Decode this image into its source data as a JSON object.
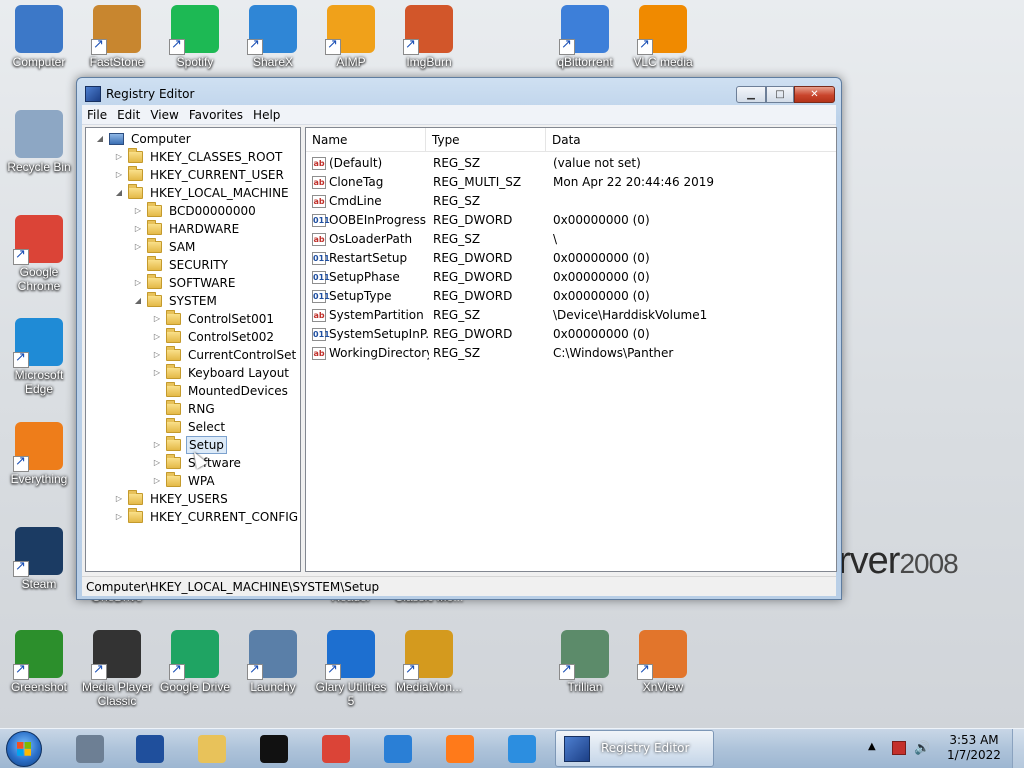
{
  "wallpaper": {
    "text": "rver",
    "small": "2008"
  },
  "desktop_icons": [
    {
      "label": "Computer",
      "icon": "computer-icon",
      "color": "#3c78c8"
    },
    {
      "label": "FastStone",
      "icon": "faststone-icon",
      "color": "#c8862f"
    },
    {
      "label": "Spotify",
      "icon": "spotify-icon",
      "color": "#1db954"
    },
    {
      "label": "ShareX",
      "icon": "sharex-icon",
      "color": "#2f86d6"
    },
    {
      "label": "AIMP",
      "icon": "aimp-icon",
      "color": "#f0a11a"
    },
    {
      "label": "ImgBurn",
      "icon": "imgburn-icon",
      "color": "#d2562a"
    },
    {
      "label": "qBittorrent",
      "icon": "qbittorrent-icon",
      "color": "#3d7fd9"
    },
    {
      "label": "VLC media",
      "icon": "vlc-icon",
      "color": "#f08a00"
    },
    {
      "label": "Recycle Bin",
      "icon": "recycle-bin-icon",
      "color": "#8da7c4"
    },
    {
      "label": "Google Chrome",
      "icon": "chrome-icon",
      "color": "#db4437"
    },
    {
      "label": "Microsoft Edge",
      "icon": "edge-icon",
      "color": "#1f8bd6"
    },
    {
      "label": "Everything",
      "icon": "everything-icon",
      "color": "#ee7d1a"
    },
    {
      "label": "Steam",
      "icon": "steam-icon",
      "color": "#1b3b63"
    },
    {
      "label": "OneDrive",
      "icon": "onedrive-icon",
      "color": "#2e74c7"
    },
    {
      "label": "Reader",
      "icon": "reader-icon",
      "color": "#c0302a"
    },
    {
      "label": "Classic Mo...",
      "icon": "classic-icon",
      "color": "#4a6a8f"
    },
    {
      "label": "Greenshot",
      "icon": "greenshot-icon",
      "color": "#2c8f2c"
    },
    {
      "label": "Media Player Classic",
      "icon": "media-player-icon",
      "color": "#333333"
    },
    {
      "label": "Google Drive",
      "icon": "google-drive-icon",
      "color": "#1fa463"
    },
    {
      "label": "Launchy",
      "icon": "launchy-icon",
      "color": "#5a7fa8"
    },
    {
      "label": "Glary Utilities 5",
      "icon": "glary-icon",
      "color": "#1d6fd0"
    },
    {
      "label": "MediaMon...",
      "icon": "mediamonkey-icon",
      "color": "#d49a1e"
    },
    {
      "label": "Trillian",
      "icon": "trillian-icon",
      "color": "#5c8b6a"
    },
    {
      "label": "XnView",
      "icon": "xnview-icon",
      "color": "#e2752b"
    }
  ],
  "window": {
    "title": "Registry Editor",
    "min_label": "▁",
    "max_label": "□",
    "close_label": "✕",
    "menu": [
      "File",
      "Edit",
      "View",
      "Favorites",
      "Help"
    ],
    "status_path": "Computer\\HKEY_LOCAL_MACHINE\\SYSTEM\\Setup"
  },
  "tree": [
    {
      "label": "Computer",
      "depth": 0,
      "exp": "◢",
      "kind": "computer"
    },
    {
      "label": "HKEY_CLASSES_ROOT",
      "depth": 1,
      "exp": "▷"
    },
    {
      "label": "HKEY_CURRENT_USER",
      "depth": 1,
      "exp": "▷"
    },
    {
      "label": "HKEY_LOCAL_MACHINE",
      "depth": 1,
      "exp": "◢"
    },
    {
      "label": "BCD00000000",
      "depth": 2,
      "exp": "▷"
    },
    {
      "label": "HARDWARE",
      "depth": 2,
      "exp": "▷"
    },
    {
      "label": "SAM",
      "depth": 2,
      "exp": "▷"
    },
    {
      "label": "SECURITY",
      "depth": 2,
      "exp": ""
    },
    {
      "label": "SOFTWARE",
      "depth": 2,
      "exp": "▷"
    },
    {
      "label": "SYSTEM",
      "depth": 2,
      "exp": "◢"
    },
    {
      "label": "ControlSet001",
      "depth": 3,
      "exp": "▷"
    },
    {
      "label": "ControlSet002",
      "depth": 3,
      "exp": "▷"
    },
    {
      "label": "CurrentControlSet",
      "depth": 3,
      "exp": "▷"
    },
    {
      "label": "Keyboard Layout",
      "depth": 3,
      "exp": "▷"
    },
    {
      "label": "MountedDevices",
      "depth": 3,
      "exp": ""
    },
    {
      "label": "RNG",
      "depth": 3,
      "exp": ""
    },
    {
      "label": "Select",
      "depth": 3,
      "exp": ""
    },
    {
      "label": "Setup",
      "depth": 3,
      "exp": "▷",
      "selected": true
    },
    {
      "label": "Software",
      "depth": 3,
      "exp": "▷"
    },
    {
      "label": "WPA",
      "depth": 3,
      "exp": "▷"
    },
    {
      "label": "HKEY_USERS",
      "depth": 1,
      "exp": "▷"
    },
    {
      "label": "HKEY_CURRENT_CONFIG",
      "depth": 1,
      "exp": "▷"
    }
  ],
  "list": {
    "columns": [
      "Name",
      "Type",
      "Data"
    ],
    "rows": [
      {
        "name": "(Default)",
        "type": "REG_SZ",
        "data": "(value not set)",
        "icon": "ab"
      },
      {
        "name": "CloneTag",
        "type": "REG_MULTI_SZ",
        "data": "Mon Apr 22 20:44:46 2019",
        "icon": "ab"
      },
      {
        "name": "CmdLine",
        "type": "REG_SZ",
        "data": "",
        "icon": "ab"
      },
      {
        "name": "OOBEInProgress",
        "type": "REG_DWORD",
        "data": "0x00000000 (0)",
        "icon": "bin"
      },
      {
        "name": "OsLoaderPath",
        "type": "REG_SZ",
        "data": "\\",
        "icon": "ab"
      },
      {
        "name": "RestartSetup",
        "type": "REG_DWORD",
        "data": "0x00000000 (0)",
        "icon": "bin"
      },
      {
        "name": "SetupPhase",
        "type": "REG_DWORD",
        "data": "0x00000000 (0)",
        "icon": "bin"
      },
      {
        "name": "SetupType",
        "type": "REG_DWORD",
        "data": "0x00000000 (0)",
        "icon": "bin"
      },
      {
        "name": "SystemPartition",
        "type": "REG_SZ",
        "data": "\\Device\\HarddiskVolume1",
        "icon": "ab"
      },
      {
        "name": "SystemSetupInP...",
        "type": "REG_DWORD",
        "data": "0x00000000 (0)",
        "icon": "bin"
      },
      {
        "name": "WorkingDirectory",
        "type": "REG_SZ",
        "data": "C:\\Windows\\Panther",
        "icon": "ab"
      }
    ]
  },
  "taskbar": {
    "pinned": [
      {
        "name": "server-manager-icon",
        "color": "#6d7f94"
      },
      {
        "name": "powershell-icon",
        "color": "#1f4f9c"
      },
      {
        "name": "explorer-icon",
        "color": "#e8c25a"
      },
      {
        "name": "cmd-icon",
        "color": "#111111"
      },
      {
        "name": "chrome-icon",
        "color": "#db4437"
      },
      {
        "name": "firefox-dev-icon",
        "color": "#2a7fd6"
      },
      {
        "name": "firefox-icon",
        "color": "#ff7a1a"
      },
      {
        "name": "ie-icon",
        "color": "#2c8ee0"
      }
    ],
    "active_label": "Registry Editor",
    "time": "3:53 AM",
    "date": "1/7/2022"
  }
}
